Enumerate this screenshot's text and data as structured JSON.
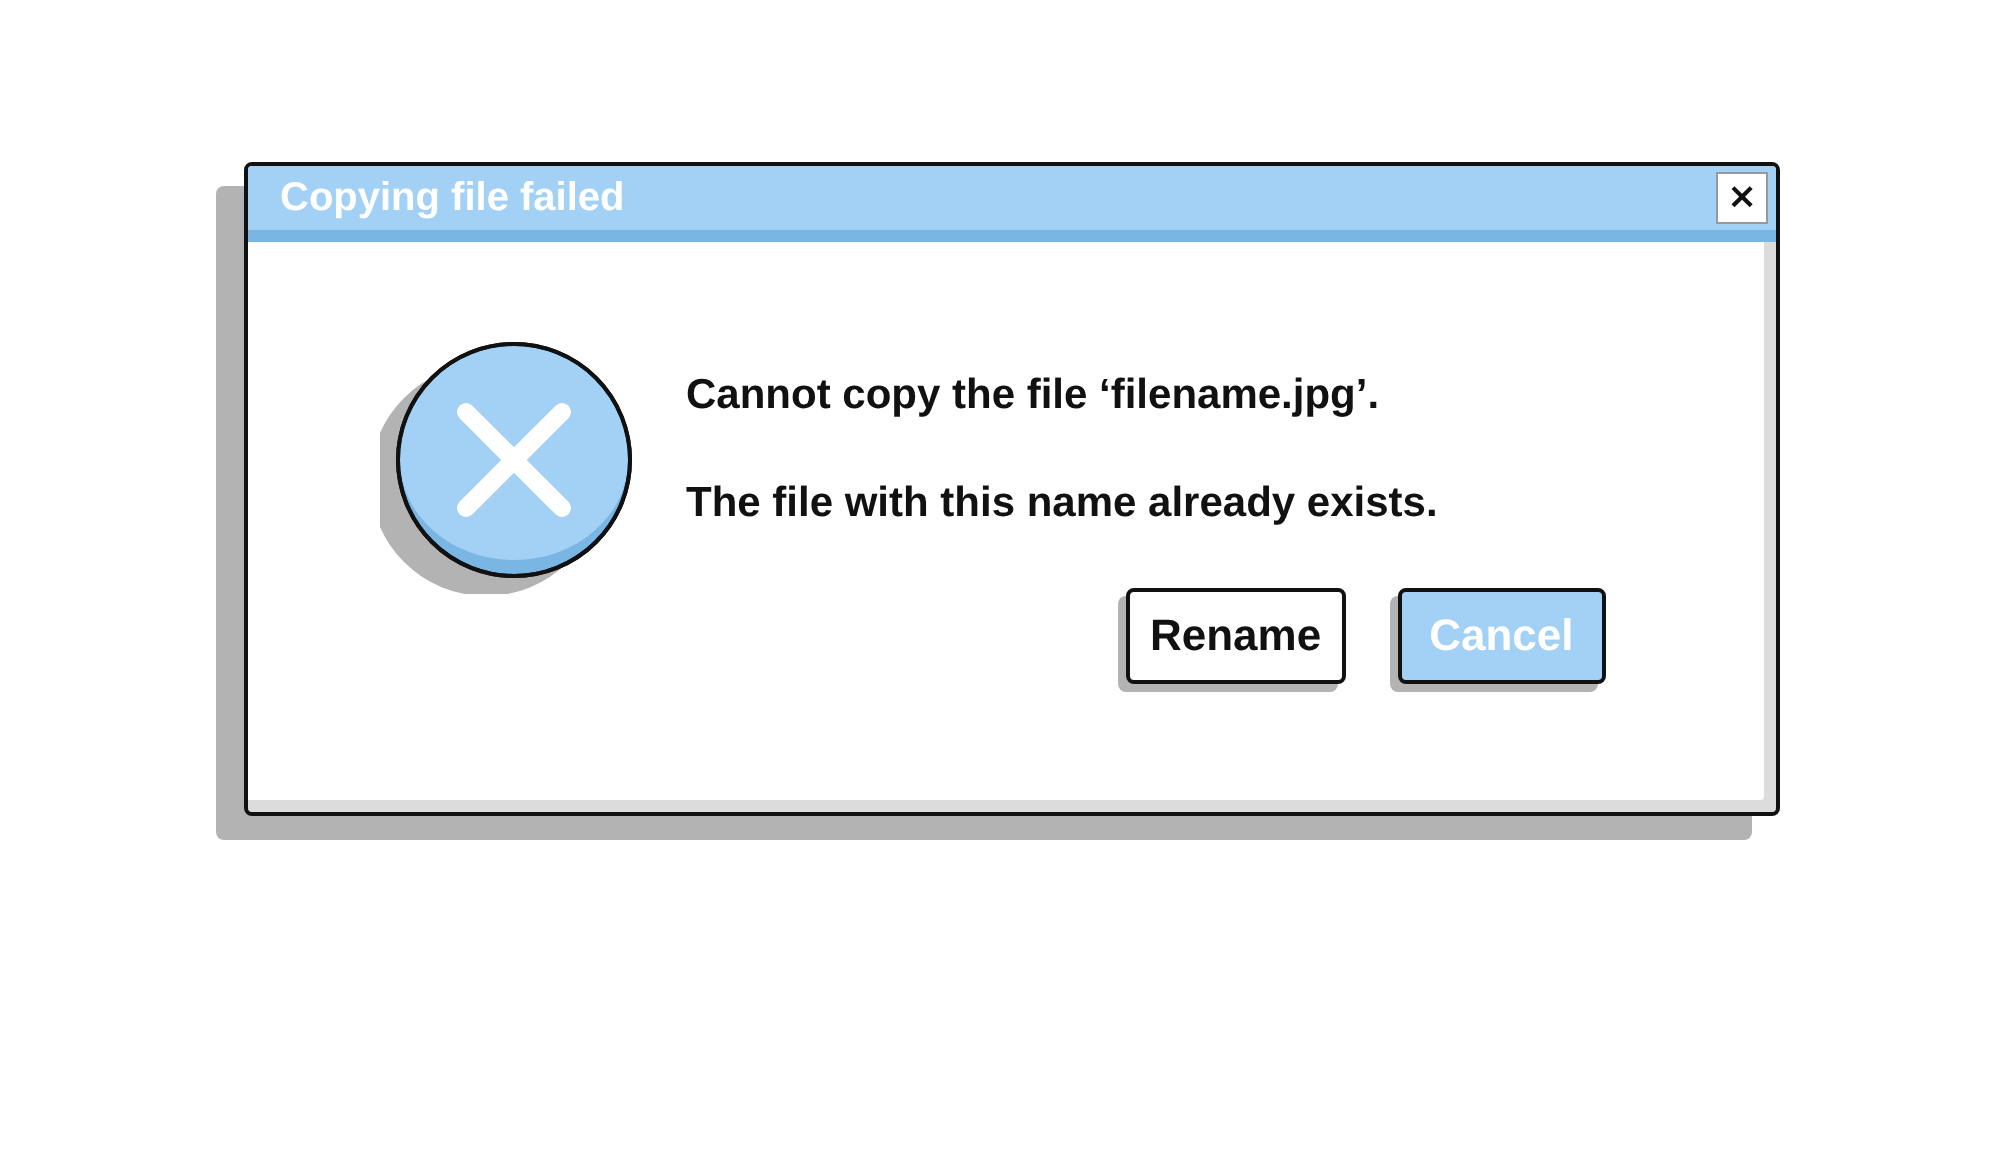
{
  "window": {
    "title": "Copying file failed",
    "close": "×"
  },
  "icon": {
    "kind": "error"
  },
  "messages": [
    "Cannot copy the file ‘filename.jpg’.",
    "The file with this name already exists."
  ],
  "buttons": [
    {
      "label": "Rename",
      "kind": "default"
    },
    {
      "label": "Cancel",
      "kind": "primary"
    }
  ]
}
